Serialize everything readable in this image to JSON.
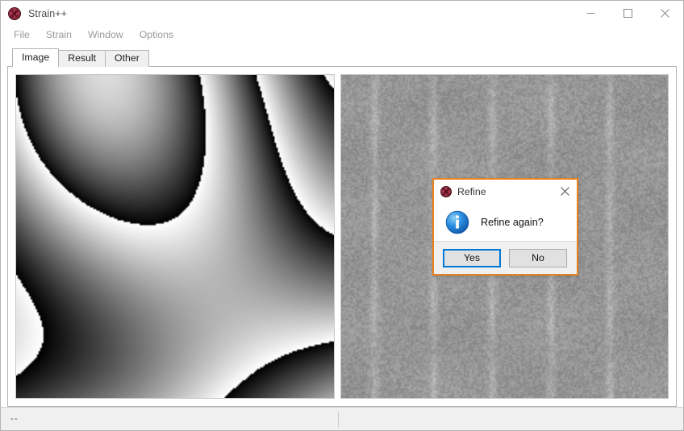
{
  "window": {
    "title": "Strain++",
    "app_icon": "strainpp-logo-icon",
    "controls": [
      {
        "name": "minimize-button",
        "glyph": "minimize-icon"
      },
      {
        "name": "maximize-button",
        "glyph": "maximize-icon"
      },
      {
        "name": "close-button",
        "glyph": "close-icon"
      }
    ]
  },
  "menu": {
    "items": [
      {
        "label": "File"
      },
      {
        "label": "Strain"
      },
      {
        "label": "Window"
      },
      {
        "label": "Options"
      }
    ]
  },
  "tabs": {
    "selected": "Image",
    "items": [
      {
        "label": "Image"
      },
      {
        "label": "Result"
      },
      {
        "label": "Other"
      }
    ]
  },
  "panels": {
    "left": {
      "name": "phase-image-panel",
      "content": "wrapped-phase-grayscale-map"
    },
    "right": {
      "name": "fft-image-panel",
      "content": "fft-diffractogram-noise"
    }
  },
  "status_bar": {
    "text": "--"
  },
  "dialog": {
    "title": "Refine",
    "icon": "strainpp-logo-icon",
    "close_label": "×",
    "message": "Refine again?",
    "message_icon": "information-icon",
    "buttons": [
      {
        "label": "Yes",
        "default": true
      },
      {
        "label": "No",
        "default": false
      }
    ]
  },
  "colors": {
    "dialog_border": "#e8821e",
    "focus_blue": "#0078d7",
    "window_border": "#b4b4b4",
    "menu_text": "#9a9a9a",
    "status_bg": "#f0f0f0"
  }
}
